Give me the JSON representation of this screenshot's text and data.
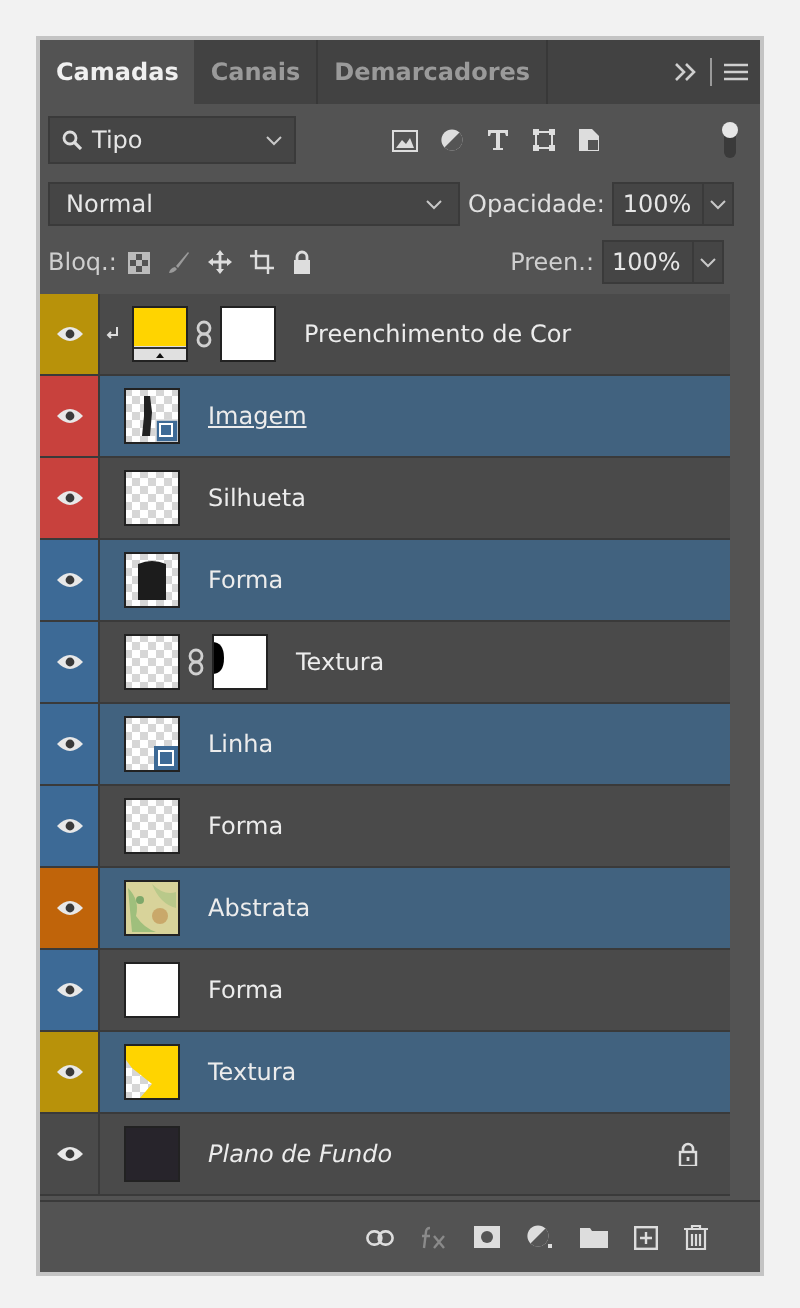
{
  "tabs": [
    {
      "label": "Camadas",
      "selected": true
    },
    {
      "label": "Canais",
      "selected": false
    },
    {
      "label": "Demarcadores",
      "selected": false
    }
  ],
  "filter": {
    "value": "Tipo",
    "on": true
  },
  "blend_mode": {
    "value": "Normal"
  },
  "opacity": {
    "label": "Opacidade:",
    "value": "100%"
  },
  "lock": {
    "label": "Bloq.:"
  },
  "fill": {
    "label": "Preen.:",
    "value": "100%"
  },
  "layers": [
    {
      "name": "Preenchimento de Cor",
      "kind": "fill",
      "color": "#b8920a",
      "selected": false,
      "visible": true,
      "clipped": true,
      "underlined": false,
      "locked": false
    },
    {
      "name": "Imagem",
      "kind": "smart",
      "color": "#c8413d",
      "selected": true,
      "visible": true,
      "clipped": false,
      "underlined": true,
      "locked": false
    },
    {
      "name": "Silhueta",
      "kind": "transparent",
      "color": "#c8413d",
      "selected": false,
      "visible": true,
      "clipped": false,
      "underlined": false,
      "locked": false
    },
    {
      "name": "Forma",
      "kind": "shape",
      "color": "#3d6a96",
      "selected": true,
      "visible": true,
      "clipped": false,
      "underlined": false,
      "locked": false
    },
    {
      "name": "Textura",
      "kind": "masked",
      "color": "#3d6a96",
      "selected": false,
      "visible": true,
      "clipped": false,
      "underlined": false,
      "locked": false
    },
    {
      "name": "Linha",
      "kind": "vector",
      "color": "#3d6a96",
      "selected": true,
      "visible": true,
      "clipped": false,
      "underlined": false,
      "locked": false
    },
    {
      "name": "Forma",
      "kind": "transparent",
      "color": "#3d6a96",
      "selected": false,
      "visible": true,
      "clipped": false,
      "underlined": false,
      "locked": false
    },
    {
      "name": "Abstrata",
      "kind": "texture",
      "color": "#c0640a",
      "selected": true,
      "visible": true,
      "clipped": false,
      "underlined": false,
      "locked": false
    },
    {
      "name": "Forma",
      "kind": "white",
      "color": "#3d6a96",
      "selected": false,
      "visible": true,
      "clipped": false,
      "underlined": false,
      "locked": false
    },
    {
      "name": "Textura",
      "kind": "yellow",
      "color": "#b8920a",
      "selected": true,
      "visible": true,
      "clipped": false,
      "underlined": false,
      "locked": false
    },
    {
      "name": "Plano de Fundo",
      "kind": "background",
      "selected": false,
      "visible": true,
      "clipped": false,
      "underlined": false,
      "locked": true
    }
  ]
}
